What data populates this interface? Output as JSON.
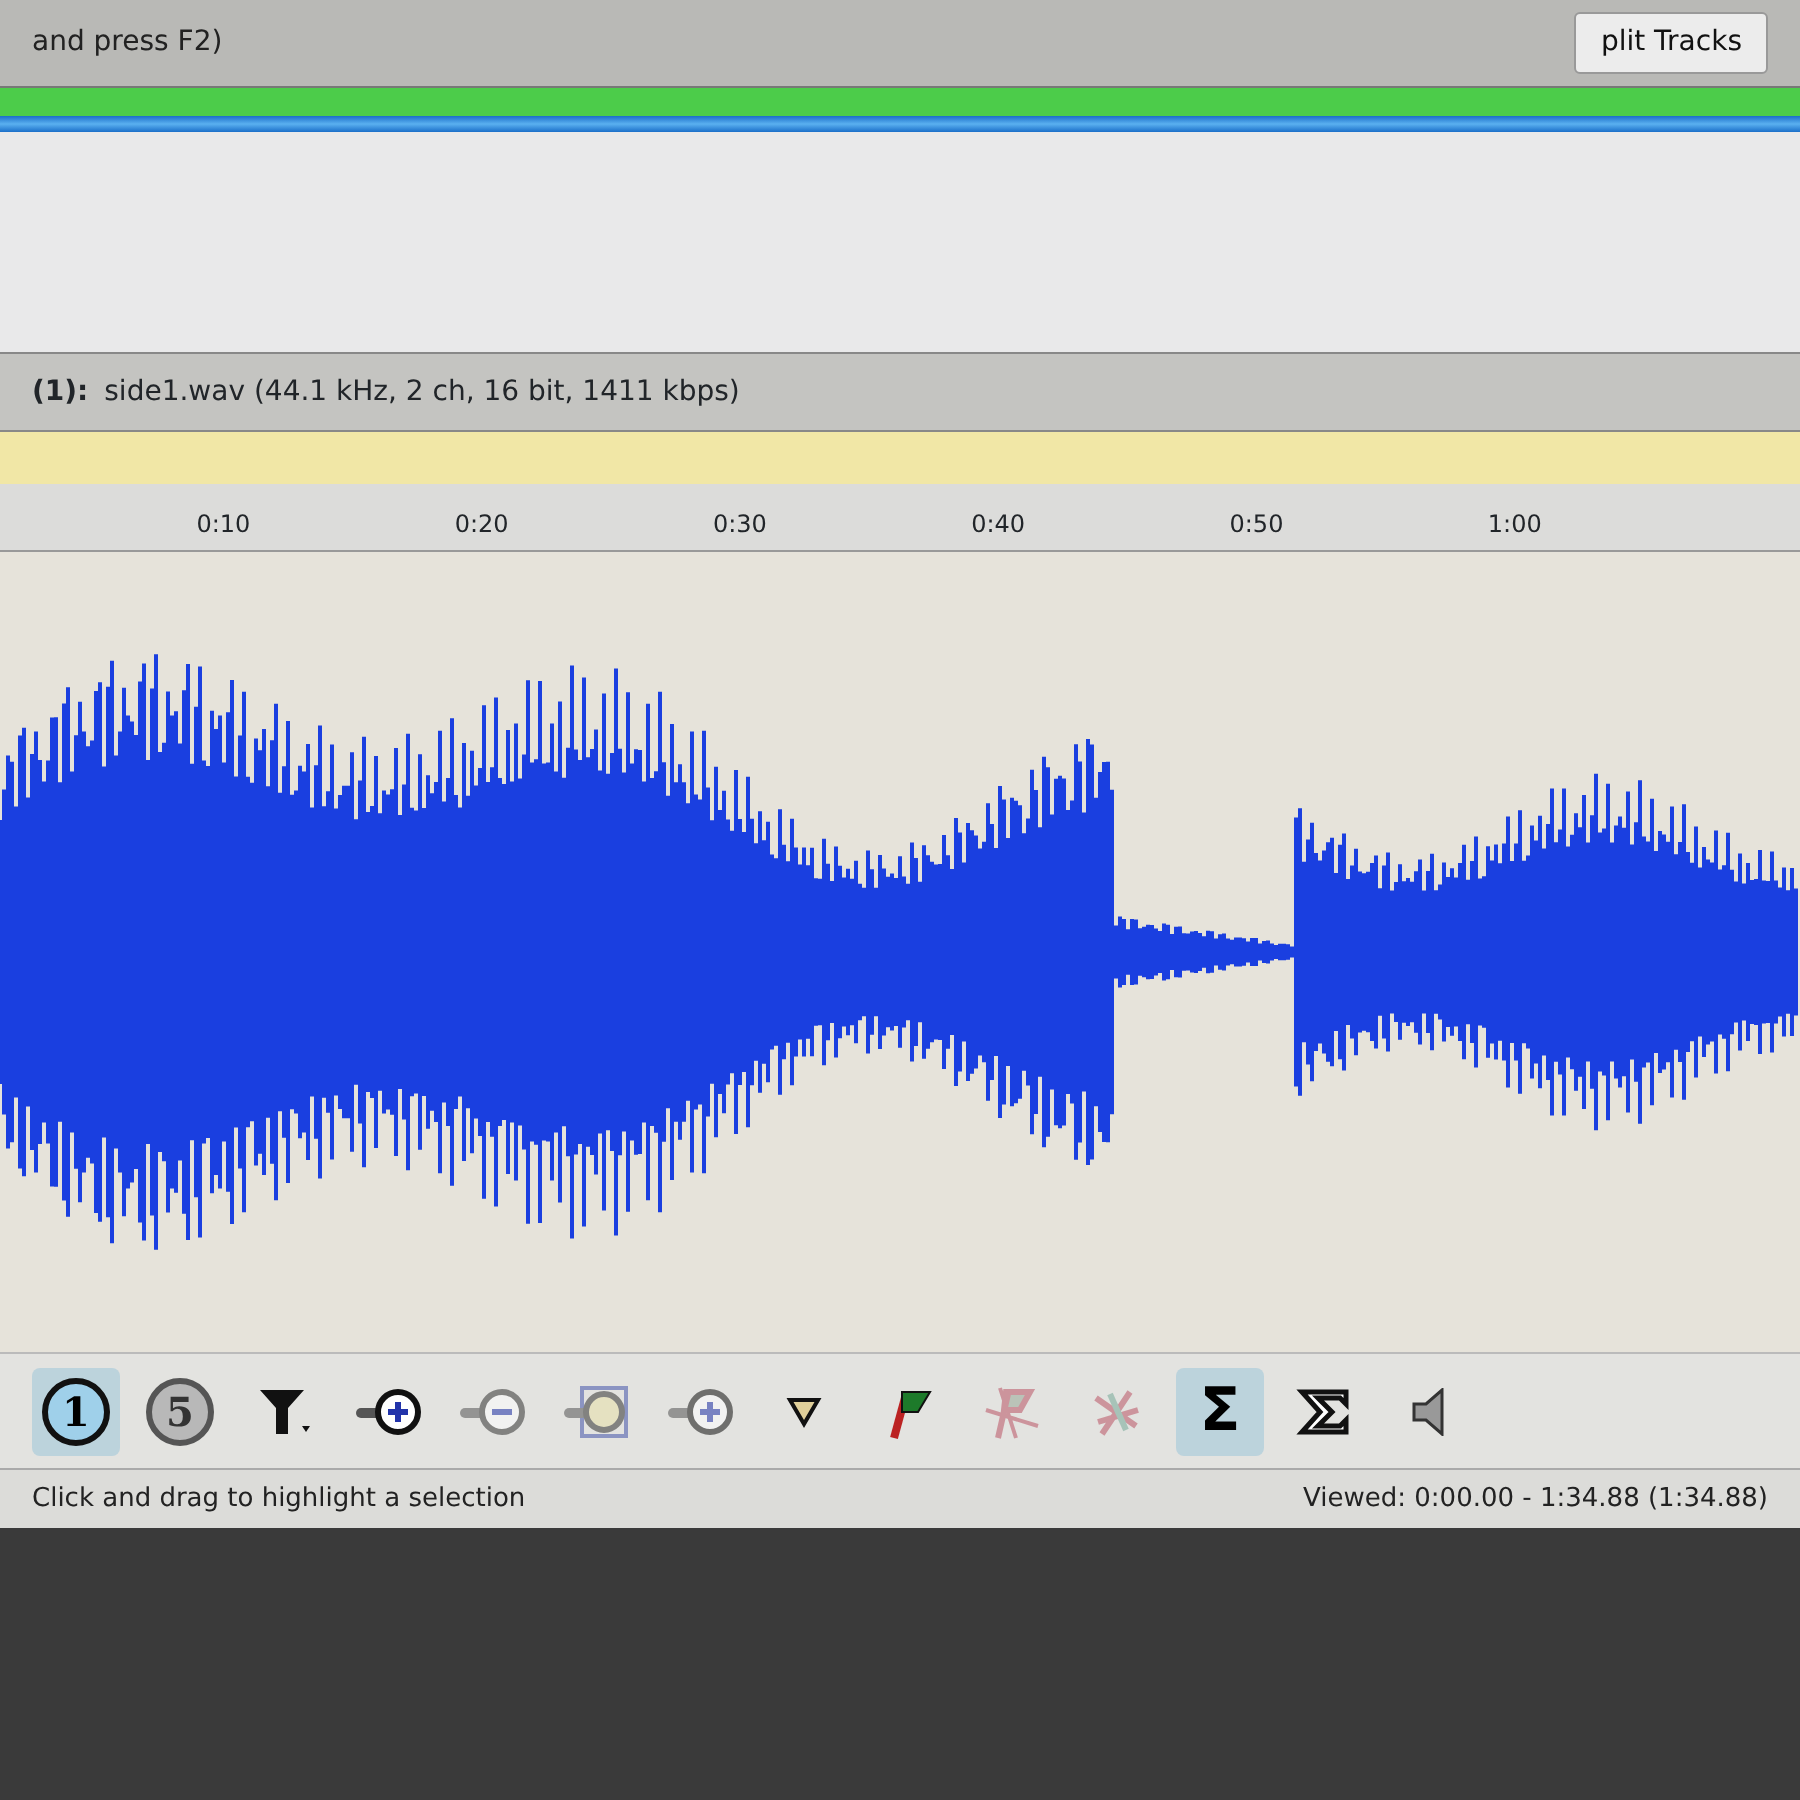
{
  "header": {
    "hint": "and press F2)",
    "split_button": "plit Tracks"
  },
  "track": {
    "number": "(1):",
    "file_info": "side1.wav (44.1 kHz, 2 ch, 16 bit, 1411 kbps)"
  },
  "ruler": {
    "ticks": [
      "0:10",
      "0:20",
      "0:30",
      "0:40",
      "0:50",
      "1:00"
    ]
  },
  "toolbar": [
    {
      "kind": "circle-num",
      "label": "1",
      "selected": true,
      "disabled": false
    },
    {
      "kind": "circle-num",
      "label": "5",
      "selected": false,
      "disabled": false
    },
    {
      "kind": "filter",
      "selected": false,
      "disabled": false
    },
    {
      "kind": "zoom-in",
      "selected": false,
      "disabled": false
    },
    {
      "kind": "zoom-out",
      "selected": false,
      "disabled": true
    },
    {
      "kind": "zoom-fit",
      "selected": false,
      "disabled": true
    },
    {
      "kind": "zoom-in",
      "selected": false,
      "disabled": true
    },
    {
      "kind": "play",
      "selected": false,
      "disabled": false
    },
    {
      "kind": "marker",
      "selected": false,
      "disabled": false
    },
    {
      "kind": "marker-remove",
      "selected": false,
      "disabled": true
    },
    {
      "kind": "marker-remove-all",
      "selected": false,
      "disabled": true
    },
    {
      "kind": "sigma",
      "label": "Σ",
      "selected": true,
      "disabled": false
    },
    {
      "kind": "sigma-outline",
      "selected": false,
      "disabled": false
    },
    {
      "kind": "speaker",
      "selected": false,
      "disabled": false
    }
  ],
  "status_bar": {
    "message": "Click and drag to highlight a selection",
    "viewed": "Viewed: 0:00.00 - 1:34.88 (1:34.88)"
  }
}
